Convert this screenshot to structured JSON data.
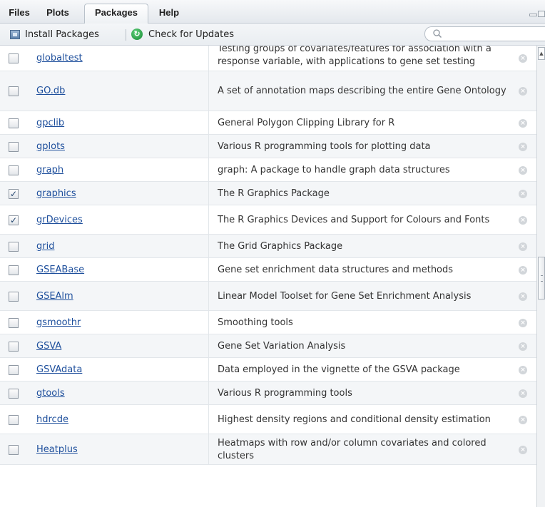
{
  "tabs": [
    {
      "label": "Files",
      "active": false
    },
    {
      "label": "Plots",
      "active": false
    },
    {
      "label": "Packages",
      "active": true
    },
    {
      "label": "Help",
      "active": false
    }
  ],
  "toolbar": {
    "install_label": "Install Packages",
    "update_label": "Check for Updates",
    "search_placeholder": ""
  },
  "packages": [
    {
      "name": "globaltest",
      "description": "Testing groups of covariates/features for association with a response variable, with applications to gene set testing",
      "checked": false
    },
    {
      "name": "GO.db",
      "description": "A set of annotation maps describing the entire Gene Ontology",
      "checked": false
    },
    {
      "name": "gpclib",
      "description": "General Polygon Clipping Library for R",
      "checked": false
    },
    {
      "name": "gplots",
      "description": "Various R programming tools for plotting data",
      "checked": false
    },
    {
      "name": "graph",
      "description": "graph: A package to handle graph data structures",
      "checked": false
    },
    {
      "name": "graphics",
      "description": "The R Graphics Package",
      "checked": true
    },
    {
      "name": "grDevices",
      "description": "The R Graphics Devices and Support for Colours and Fonts",
      "checked": true
    },
    {
      "name": "grid",
      "description": "The Grid Graphics Package",
      "checked": false
    },
    {
      "name": "GSEABase",
      "description": "Gene set enrichment data structures and methods",
      "checked": false
    },
    {
      "name": "GSEAlm",
      "description": "Linear Model Toolset for Gene Set Enrichment Analysis",
      "checked": false
    },
    {
      "name": "gsmoothr",
      "description": "Smoothing tools",
      "checked": false
    },
    {
      "name": "GSVA",
      "description": "Gene Set Variation Analysis",
      "checked": false
    },
    {
      "name": "GSVAdata",
      "description": "Data employed in the vignette of the GSVA package",
      "checked": false
    },
    {
      "name": "gtools",
      "description": "Various R programming tools",
      "checked": false
    },
    {
      "name": "hdrcde",
      "description": "Highest density regions and conditional density estimation",
      "checked": false
    },
    {
      "name": "Heatplus",
      "description": "Heatmaps with row and/or column covariates and colored clusters",
      "checked": false
    }
  ],
  "icons": {
    "install": "package-icon",
    "update": "refresh-icon",
    "search": "search-icon",
    "remove": "remove-icon",
    "check": "✓"
  },
  "colors": {
    "link": "#1e4f9c",
    "alt_row": "#f4f6f8",
    "update_icon": "#168a34"
  }
}
